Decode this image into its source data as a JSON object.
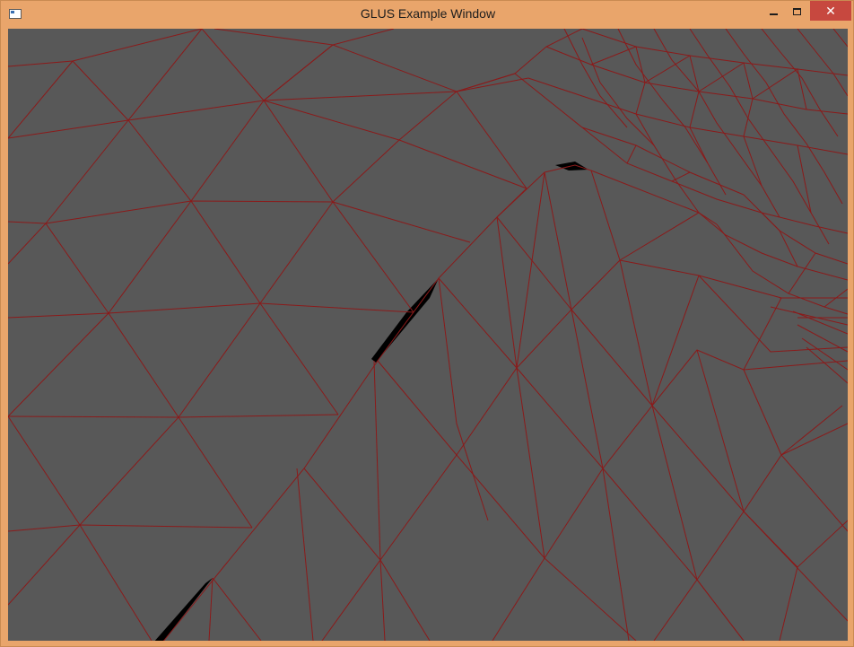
{
  "window": {
    "title": "GLUS Example Window",
    "icon": "app-window-icon",
    "controls": {
      "minimize_icon": "minimize-icon",
      "maximize_icon": "maximize-icon",
      "close_icon": "close-icon",
      "close_glyph": "✕"
    }
  },
  "viewport": {
    "background_color": "#585858",
    "wireframe_color": "#8b1a1a",
    "gap_color": "#000000"
  }
}
